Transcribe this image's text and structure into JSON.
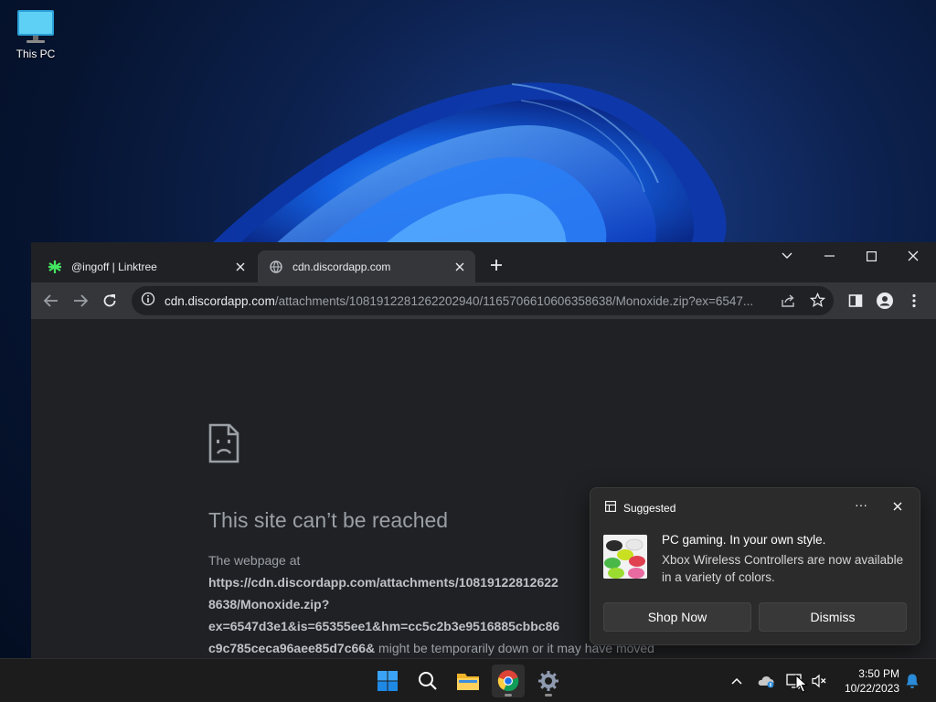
{
  "desktop": {
    "icon_label": "This PC"
  },
  "browser": {
    "tabs": [
      {
        "title": "@ingoff | Linktree",
        "active": false
      },
      {
        "title": "cdn.discordapp.com",
        "active": true
      }
    ],
    "address": {
      "host": "cdn.discordapp.com",
      "path": "/attachments/1081912281262202940/1165706610606358638/Monoxide.zip?ex=6547..."
    },
    "error": {
      "title": "This site can’t be reached",
      "line1": "The webpage at",
      "url_line1": "https://cdn.discordapp.com/attachments/10819122812622",
      "url_line2": "8638/Monoxide.zip?",
      "url_line3": "ex=6547d3e1&is=65355ee1&hm=cc5c2b3e9516885cbbc86",
      "url_line4": "c9c785ceca96aee85d7c66&",
      "suffix": " might be temporarily down or it may have moved"
    }
  },
  "notification": {
    "header": "Suggested",
    "more": "···",
    "headline": "PC gaming. In your own style.",
    "body": "Xbox Wireless Controllers are now available in a variety of colors.",
    "primary_button": "Shop Now",
    "secondary_button": "Dismiss"
  },
  "taskbar": {
    "time": "3:50 PM",
    "date": "10/22/2023"
  },
  "colors": {
    "accent_blue": "#0a68e0",
    "browser_bg": "#202124",
    "toolbar_bg": "#35363a"
  }
}
